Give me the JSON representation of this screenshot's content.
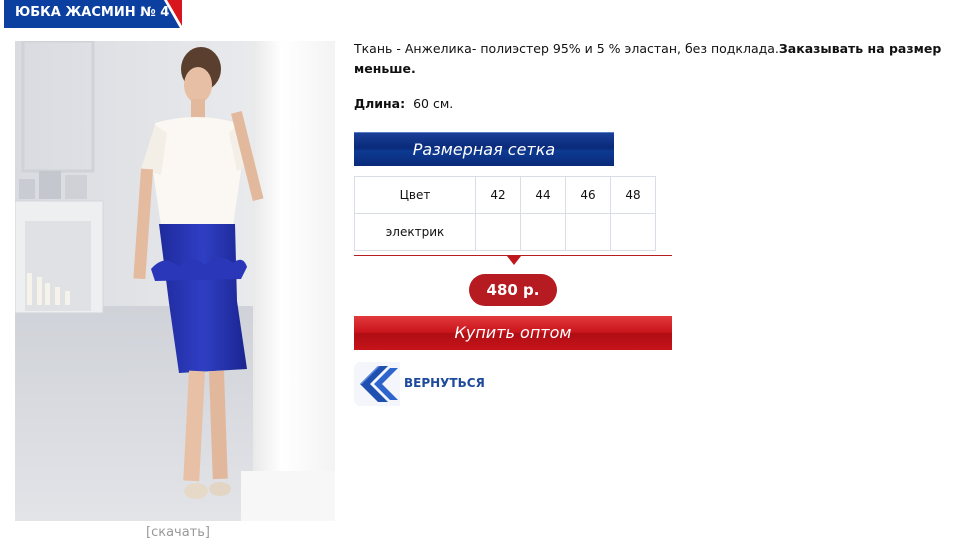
{
  "product": {
    "title": "ЮБКА ЖАСМИН № 4",
    "description_text": "Ткань - Анжелика-  полиэстер 95% и 5 % эластан, без подклада.",
    "description_bold": "Заказывать на размер меньше.",
    "length_label": "Длина:",
    "length_value": "60 см.",
    "photo_alt": "Юбка Жасмин № 4",
    "download_label": "[скачать]"
  },
  "size_grid_button": "Размерная сетка",
  "size_table": {
    "header": [
      "Цвет",
      "42",
      "44",
      "46",
      "48"
    ],
    "rows": [
      [
        "электрик",
        "",
        "",
        "",
        ""
      ]
    ]
  },
  "price": "480 р.",
  "buy_button": "Купить оптом",
  "back_link": "ВЕРНУТЬСЯ",
  "colors": {
    "brand_blue": "#0a2a7a",
    "accent_red": "#c0171d",
    "link_blue": "#1e4a9c"
  },
  "icons": {
    "title_corner": "red-triangle-corner",
    "back": "double-chevron-left-icon"
  }
}
